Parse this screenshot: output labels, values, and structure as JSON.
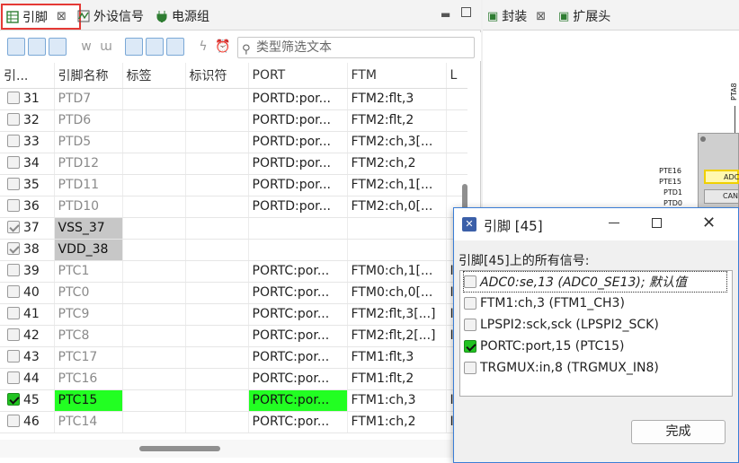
{
  "left_tabs": [
    {
      "label": "引脚",
      "active": true,
      "close": "⊠"
    },
    {
      "label": "外设信号"
    },
    {
      "label": "电源组"
    }
  ],
  "right_tabs": [
    {
      "label": "封装",
      "close": "⊠"
    },
    {
      "label": "扩展头"
    }
  ],
  "filter": {
    "placeholder": "类型筛选文本"
  },
  "table": {
    "columns": [
      "引...",
      "引脚名称",
      "标签",
      "标识符",
      "PORT",
      "FTM",
      "L"
    ],
    "rows": [
      {
        "num": "31",
        "checked": false,
        "name": "PTD7",
        "port": "PORTD:por...",
        "ftm": "FTM2:flt,3"
      },
      {
        "num": "32",
        "checked": false,
        "name": "PTD6",
        "port": "PORTD:por...",
        "ftm": "FTM2:flt,2"
      },
      {
        "num": "33",
        "checked": false,
        "name": "PTD5",
        "port": "PORTD:por...",
        "ftm": "FTM2:ch,3[..."
      },
      {
        "num": "34",
        "checked": false,
        "name": "PTD12",
        "port": "PORTD:por...",
        "ftm": "FTM2:ch,2"
      },
      {
        "num": "35",
        "checked": false,
        "name": "PTD11",
        "port": "PORTD:por...",
        "ftm": "FTM2:ch,1[..."
      },
      {
        "num": "36",
        "checked": false,
        "name": "PTD10",
        "port": "PORTD:por...",
        "ftm": "FTM2:ch,0[..."
      },
      {
        "num": "37",
        "checked": true,
        "name": "VSS_37",
        "port": "",
        "ftm": "",
        "power": true
      },
      {
        "num": "38",
        "checked": true,
        "name": "VDD_38",
        "port": "",
        "ftm": "",
        "power": true
      },
      {
        "num": "39",
        "checked": false,
        "name": "PTC1",
        "port": "PORTC:por...",
        "ftm": "FTM0:ch,1[..."
      },
      {
        "num": "40",
        "checked": false,
        "name": "PTC0",
        "port": "PORTC:por...",
        "ftm": "FTM0:ch,0[..."
      },
      {
        "num": "41",
        "checked": false,
        "name": "PTC9",
        "port": "PORTC:por...",
        "ftm": "FTM2:flt,3[...]"
      },
      {
        "num": "42",
        "checked": false,
        "name": "PTC8",
        "port": "PORTC:por...",
        "ftm": "FTM2:flt,2[...]"
      },
      {
        "num": "43",
        "checked": false,
        "name": "PTC17",
        "port": "PORTC:por...",
        "ftm": "FTM1:flt,3"
      },
      {
        "num": "44",
        "checked": false,
        "name": "PTC16",
        "port": "PORTC:por...",
        "ftm": "FTM1:flt,2"
      },
      {
        "num": "45",
        "checked": true,
        "name": "PTC15",
        "port": "PORTC:por...",
        "ftm": "FTM1:ch,3",
        "highlight": true
      },
      {
        "num": "46",
        "checked": false,
        "name": "PTC14",
        "port": "PORTC:por...",
        "ftm": "FTM1:ch,2"
      }
    ],
    "last_col_marks": {
      "39": "I",
      "40": "I",
      "41": "I",
      "42": "I",
      "45": "I",
      "46": "I"
    }
  },
  "package": {
    "top_pin": "PTA8",
    "left_pins": [
      "PTE16",
      "PTE15",
      "PTD1",
      "PTD0"
    ],
    "pads": [
      "ADC",
      "CAN"
    ]
  },
  "dialog": {
    "title": "引脚 [45]",
    "subtitle": "引脚[45]上的所有信号:",
    "signals": [
      {
        "label": "ADC0:se,13 (ADC0_SE13); 默认值",
        "checked": false,
        "italic": true,
        "selected": true
      },
      {
        "label": "FTM1:ch,3 (FTM1_CH3)",
        "checked": false
      },
      {
        "label": "LPSPI2:sck,sck (LPSPI2_SCK)",
        "checked": false
      },
      {
        "label": "PORTC:port,15 (PTC15)",
        "checked": true
      },
      {
        "label": "TRGMUX:in,8 (TRGMUX_IN8)",
        "checked": false
      }
    ],
    "done_label": "完成"
  }
}
